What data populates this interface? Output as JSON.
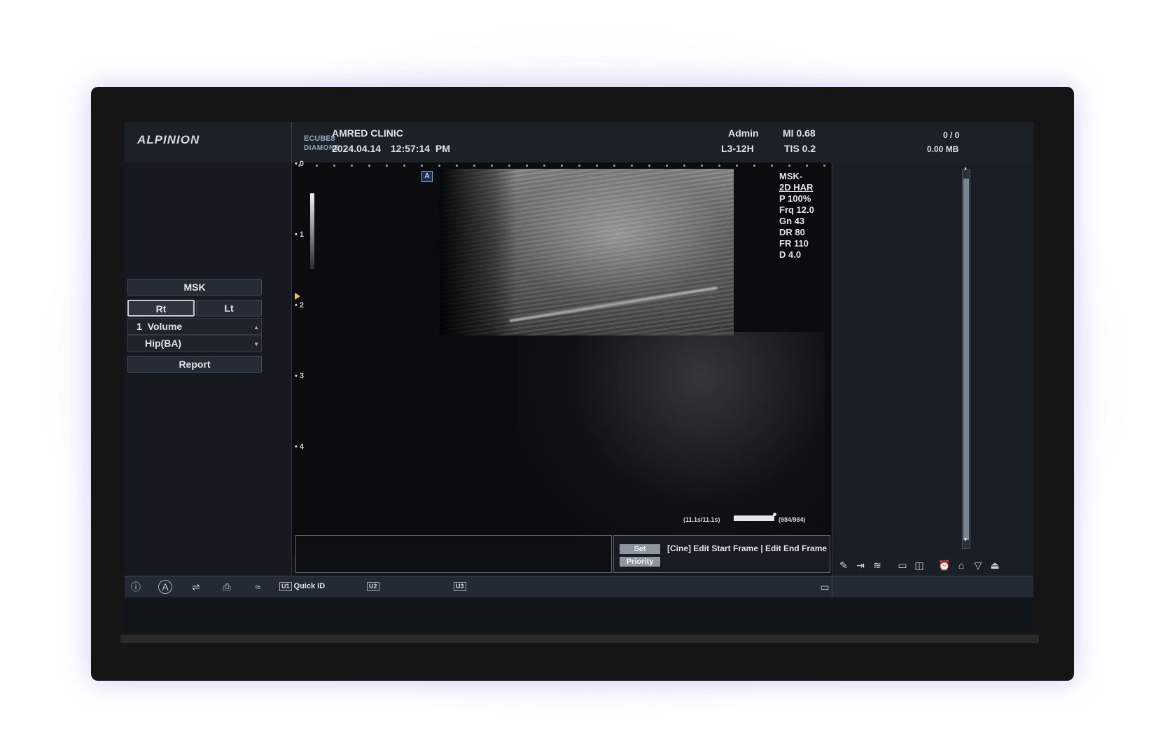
{
  "header": {
    "brand": "ALPINION",
    "product_line1": "ECUBE8",
    "product_line2": "DIAMOND",
    "clinic": "AMRED CLINIC",
    "date": "2024.04.14",
    "time": "12:57:14",
    "ampm": "PM",
    "user": "Admin",
    "probe": "L3-12H",
    "mi": "MI 0.68",
    "tis": "TIS 0.2",
    "count": "0 / 0",
    "storage": "0.00 MB"
  },
  "left_panel": {
    "preset": "MSK",
    "side_rt": "Rt",
    "side_lt": "Lt",
    "volume_index": "1",
    "volume_label": "Volume",
    "hip_label": "Hip(BA)",
    "report": "Report"
  },
  "image": {
    "depth_ticks": [
      "0",
      "1",
      "2",
      "3",
      "4"
    ],
    "params": [
      "MSK-",
      "2D HAR",
      "P 100%",
      "Frq 12.0",
      "Gn 43",
      "DR 80",
      "FR 110",
      "D 4.0"
    ],
    "cine_time": "(11.1s/11.1s)",
    "cine_frames": "(984/984)",
    "cine_progress": 1.0,
    "auto_icon_glyph": "A"
  },
  "set_panel": {
    "set": "Set",
    "priority": "Priority",
    "cine_help": "[Cine] Edit Start Frame | Edit End Frame"
  },
  "taskbar": {
    "u1": "U1",
    "quick_id": "Quick ID",
    "u2": "U2",
    "u3": "U3"
  },
  "icons": {
    "taskbar": [
      "info-icon",
      "auto-icon",
      "usb-icon",
      "printer-icon",
      "wifi-icon",
      "monitor-icon"
    ],
    "right_tools": [
      "pencil-icon",
      "export-icon",
      "database-icon",
      "single-layout-icon",
      "dual-layout-icon",
      "alarm-icon",
      "home-icon",
      "down-icon",
      "eject-icon"
    ]
  },
  "colors": {
    "screen_bg": "#111418",
    "focus_marker": "#e5c44b",
    "button_grey": "#8e979f"
  }
}
